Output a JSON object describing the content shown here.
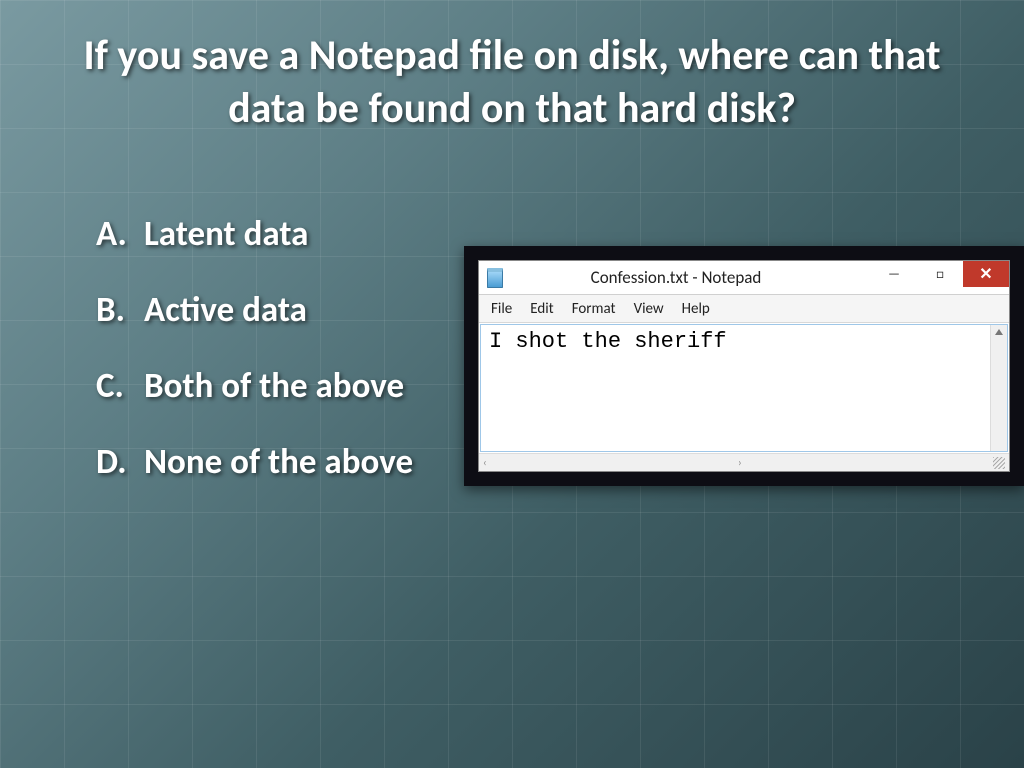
{
  "question": "If you save a Notepad file on disk, where can that data be found on that hard disk?",
  "answers": [
    {
      "letter": "A.",
      "text": "Latent data"
    },
    {
      "letter": "B.",
      "text": "Active data"
    },
    {
      "letter": "C.",
      "text": "Both of the above"
    },
    {
      "letter": "D.",
      "text": "None of the above"
    }
  ],
  "notepad": {
    "title": "Confession.txt - Notepad",
    "menu": [
      "File",
      "Edit",
      "Format",
      "View",
      "Help"
    ],
    "content": "I shot the sheriff",
    "minimize": "—",
    "maximize": "□",
    "close": "✕",
    "scroll_left": "‹",
    "scroll_right": "›"
  }
}
